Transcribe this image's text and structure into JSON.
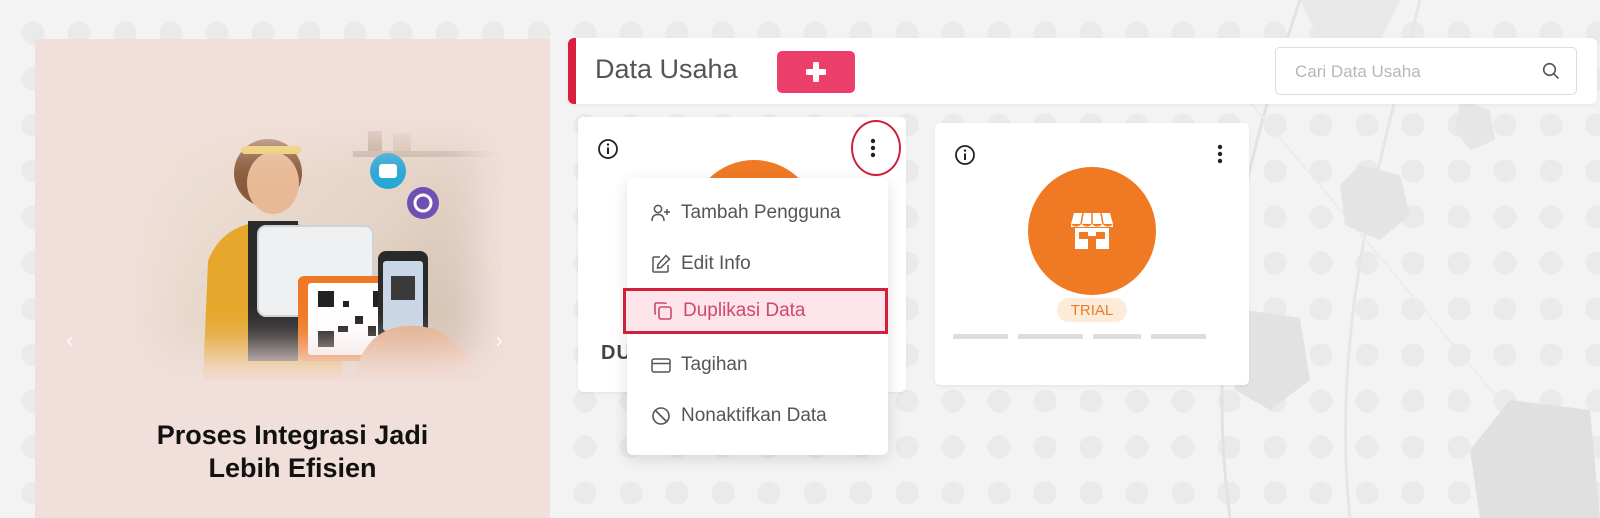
{
  "promo": {
    "title_line1": "Proses Integrasi Jadi",
    "title_line2": "Lebih Efisien",
    "prev_arrow": "‹",
    "next_arrow": "›"
  },
  "header": {
    "title": "Data Usaha",
    "add_button_icon": "plus-icon",
    "search_placeholder": "Cari Data Usaha",
    "accent_color": "#d81f3e",
    "button_color": "#ea3f68"
  },
  "cards": [
    {
      "name": "DU",
      "icon": "store-icon",
      "circle_color": "#f07a24"
    },
    {
      "badge": "TRIAL",
      "icon": "store-icon",
      "circle_color": "#f07a24"
    }
  ],
  "menu": {
    "items": [
      {
        "label": "Tambah Pengguna",
        "icon": "user-plus-icon"
      },
      {
        "label": "Edit Info",
        "icon": "edit-icon"
      },
      {
        "label": "Duplikasi Data",
        "icon": "copy-icon",
        "selected": true
      },
      {
        "label": "Tagihan",
        "icon": "credit-card-icon"
      },
      {
        "label": "Nonaktifkan Data",
        "icon": "ban-icon"
      }
    ],
    "highlight_color": "#d0203a"
  }
}
